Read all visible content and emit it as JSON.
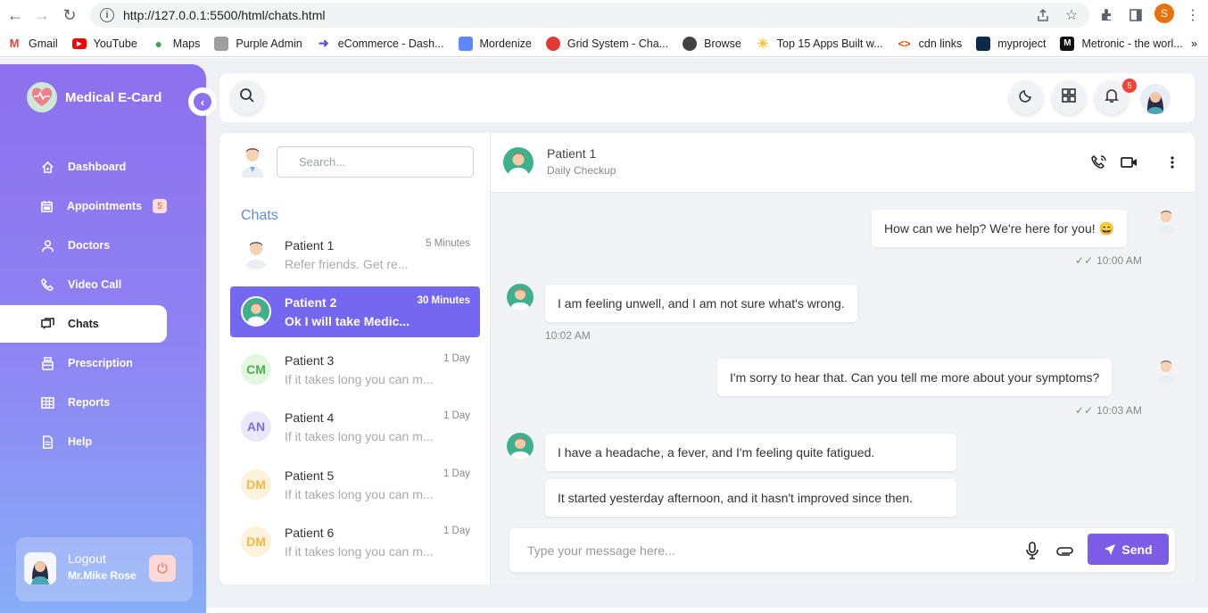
{
  "browser": {
    "url": "http://127.0.0.1:5500/html/chats.html",
    "profile_initial": "S",
    "bookmarks": [
      {
        "label": "Gmail",
        "icon": "gmail-icon",
        "color": "#ea4335"
      },
      {
        "label": "YouTube",
        "icon": "youtube-icon",
        "color": "#ff0000"
      },
      {
        "label": "Maps",
        "icon": "maps-icon",
        "color": "#34a853"
      },
      {
        "label": "Purple Admin",
        "icon": "page-icon",
        "color": "#9e9e9e"
      },
      {
        "label": "eCommerce - Dash...",
        "icon": "bolt-icon",
        "color": "#6c4de6"
      },
      {
        "label": "Mordenize",
        "icon": "mordenize-icon",
        "color": "#5d87ff"
      },
      {
        "label": "Grid System - Cha...",
        "icon": "grid-system-icon",
        "color": "#e53935"
      },
      {
        "label": "Browse",
        "icon": "globe-icon",
        "color": "#424242"
      },
      {
        "label": "Top 15 Apps Built w...",
        "icon": "sun-icon",
        "color": "#f6c23e"
      },
      {
        "label": "cdn links",
        "icon": "code-icon",
        "color": "#e65100"
      },
      {
        "label": "myproject",
        "icon": "myproject-icon",
        "color": "#0d2a4a"
      },
      {
        "label": "Metronic - the worl...",
        "icon": "metronic-icon",
        "color": "#111111"
      }
    ],
    "more": "»"
  },
  "sidebar": {
    "brand": "Medical E-Card",
    "items": [
      {
        "label": "Dashboard",
        "icon": "home-icon"
      },
      {
        "label": "Appointments",
        "icon": "calendar-icon",
        "badge": "5"
      },
      {
        "label": "Doctors",
        "icon": "user-icon"
      },
      {
        "label": "Video Call",
        "icon": "phone-icon"
      },
      {
        "label": "Chats",
        "icon": "chats-icon",
        "active": true
      },
      {
        "label": "Prescription",
        "icon": "prescription-icon"
      },
      {
        "label": "Reports",
        "icon": "table-icon"
      },
      {
        "label": "Help",
        "icon": "document-icon"
      }
    ],
    "logout": {
      "label": "Logout",
      "user": "Mr.Mike Rose"
    }
  },
  "topbar": {
    "notification_count": "5"
  },
  "chat_list": {
    "search_placeholder": "Search...",
    "title": "Chats",
    "items": [
      {
        "name": "Patient 1",
        "time": "5 Minutes",
        "preview": "Refer friends. Get re...",
        "avatar": "doctor"
      },
      {
        "name": "Patient 2",
        "time": "30 Minutes",
        "preview": "Ok I will take Medic...",
        "avatar": "patient",
        "active": true
      },
      {
        "name": "Patient 3",
        "time": "1 Day",
        "preview": "If it takes long you can m...",
        "initials": "CM",
        "color": "#4caf50",
        "bg": "#e3f7e0"
      },
      {
        "name": "Patient 4",
        "time": "1 Day",
        "preview": "If it takes long you can m...",
        "initials": "AN",
        "color": "#7c6ee0",
        "bg": "#ebe8fb"
      },
      {
        "name": "Patient 5",
        "time": "1 Day",
        "preview": "If it takes long you can m...",
        "initials": "DM",
        "color": "#f5b942",
        "bg": "#fdf3dd"
      },
      {
        "name": "Patient 6",
        "time": "1 Day",
        "preview": "If it takes long you can m...",
        "initials": "DM",
        "color": "#f5b942",
        "bg": "#fdf3dd"
      }
    ]
  },
  "conversation": {
    "name": "Patient 1",
    "status": "Daily Checkup",
    "messages": [
      {
        "side": "right",
        "text": "How can we help? We're here for you! 😄",
        "time": "10:00 AM"
      },
      {
        "side": "left",
        "text": "I am feeling unwell, and I am not sure what's wrong.",
        "time": "10:02 AM"
      },
      {
        "side": "right",
        "text": "I'm sorry to hear that. Can you tell me more about your symptoms?",
        "time": "10:03 AM"
      },
      {
        "side": "left",
        "text": "I have a headache, a fever, and I'm feeling quite fatigued."
      },
      {
        "side": "left",
        "text": "It started yesterday afternoon, and it hasn't improved since then."
      }
    ],
    "input_placeholder": "Type your message here...",
    "send_label": "Send"
  }
}
